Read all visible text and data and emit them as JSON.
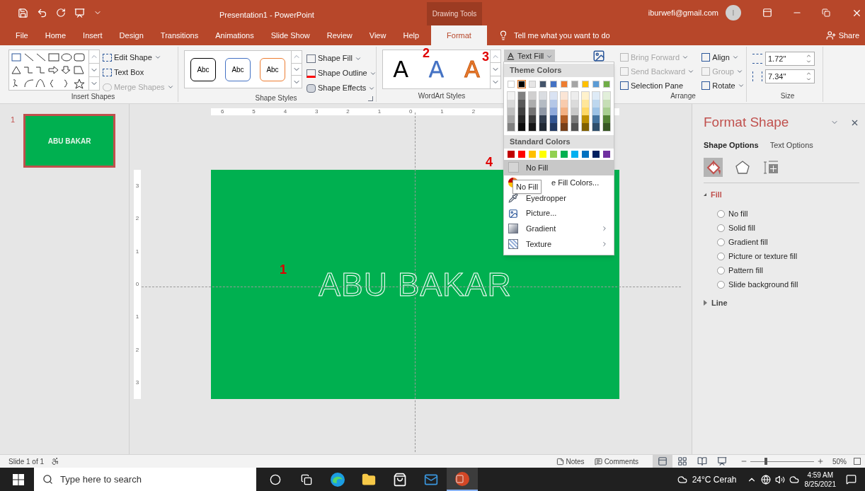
{
  "title_bar": {
    "title": "Presentation1 - PowerPoint",
    "context_tab": "Drawing Tools",
    "account": "iburwefi@gmail.com",
    "avatar_initial": "I"
  },
  "tabs": [
    {
      "label": "File",
      "selected": false
    },
    {
      "label": "Home",
      "selected": false
    },
    {
      "label": "Insert",
      "selected": false
    },
    {
      "label": "Design",
      "selected": false
    },
    {
      "label": "Transitions",
      "selected": false
    },
    {
      "label": "Animations",
      "selected": false
    },
    {
      "label": "Slide Show",
      "selected": false
    },
    {
      "label": "Review",
      "selected": false
    },
    {
      "label": "View",
      "selected": false
    },
    {
      "label": "Help",
      "selected": false
    },
    {
      "label": "Format",
      "selected": true
    }
  ],
  "tell_me": "Tell me what you want to do",
  "share": "Share",
  "ribbon": {
    "insert_shapes": {
      "label": "Insert Shapes",
      "commands": [
        {
          "label": "Edit Shape",
          "disabled": false
        },
        {
          "label": "Text Box",
          "disabled": false
        },
        {
          "label": "Merge Shapes",
          "disabled": true
        }
      ]
    },
    "shape_styles": {
      "label": "Shape Styles",
      "presets": [
        {
          "label": "Abc",
          "color": "#000000"
        },
        {
          "label": "Abc",
          "color": "#4472c4"
        },
        {
          "label": "Abc",
          "color": "#ed7d31"
        }
      ],
      "commands": [
        {
          "label": "Shape Fill"
        },
        {
          "label": "Shape Outline"
        },
        {
          "label": "Shape Effects"
        }
      ]
    },
    "wordart_styles": {
      "label": "WordArt Styles",
      "presets": [
        {
          "label": "A",
          "kind": "solid",
          "color": "#000000"
        },
        {
          "label": "A",
          "kind": "gradient",
          "color": "#4472c4"
        },
        {
          "label": "A",
          "kind": "outline",
          "color": "#ed7d31"
        }
      ],
      "text_fill": "Text Fill"
    },
    "arrange": {
      "label": "Arrange",
      "commands": [
        {
          "label": "Bring Forward",
          "disabled": true
        },
        {
          "label": "Send Backward",
          "disabled": true
        },
        {
          "label": "Selection Pane",
          "disabled": false
        },
        {
          "label": "Align",
          "disabled": false
        },
        {
          "label": "Group",
          "disabled": true
        },
        {
          "label": "Rotate",
          "disabled": false
        }
      ]
    },
    "size": {
      "label": "Size",
      "height": "1.72\"",
      "width": "7.34\""
    }
  },
  "thumbnails": [
    {
      "number": "1",
      "text": "ABU BAKAR",
      "selected": true
    }
  ],
  "rulers": {
    "horizontal": [
      "6",
      "5",
      "4",
      "3",
      "2",
      "1",
      "0",
      "1",
      "2"
    ],
    "vertical": [
      "3",
      "2",
      "1",
      "0",
      "1",
      "2",
      "3"
    ]
  },
  "slide": {
    "text": "ABU BAKAR"
  },
  "annotations": [
    {
      "label": "1"
    },
    {
      "label": "2"
    },
    {
      "label": "3"
    },
    {
      "label": "4"
    }
  ],
  "text_fill_menu": {
    "theme_header": "Theme Colors",
    "theme_colors": [
      {
        "color": "#ffffff",
        "selected": false
      },
      {
        "color": "#000000",
        "selected": true
      },
      {
        "color": "#e7e6e6",
        "selected": false
      },
      {
        "color": "#44546a",
        "selected": false
      },
      {
        "color": "#4472c4",
        "selected": false
      },
      {
        "color": "#ed7d31",
        "selected": false
      },
      {
        "color": "#a5a5a5",
        "selected": false
      },
      {
        "color": "#ffc000",
        "selected": false
      },
      {
        "color": "#5b9bd5",
        "selected": false
      },
      {
        "color": "#70ad47",
        "selected": false
      }
    ],
    "standard_header": "Standard Colors",
    "standard_colors": [
      {
        "color": "#c00000"
      },
      {
        "color": "#ff0000"
      },
      {
        "color": "#ffc000"
      },
      {
        "color": "#ffff00"
      },
      {
        "color": "#92d050"
      },
      {
        "color": "#00b050"
      },
      {
        "color": "#00b0f0"
      },
      {
        "color": "#0070c0"
      },
      {
        "color": "#002060"
      },
      {
        "color": "#7030a0"
      }
    ],
    "items": [
      {
        "label": "No Fill",
        "kind": "nofill",
        "selected": true,
        "submenu": false
      },
      {
        "label": "e Fill Colors...",
        "kind": "more",
        "selected": false,
        "submenu": false
      },
      {
        "label": "Eyedropper",
        "kind": "eyedropper",
        "selected": false,
        "submenu": false
      },
      {
        "label": "Picture...",
        "kind": "picture",
        "selected": false,
        "submenu": false
      },
      {
        "label": "Gradient",
        "kind": "gradient",
        "selected": false,
        "submenu": true
      },
      {
        "label": "Texture",
        "kind": "texture",
        "selected": false,
        "submenu": true
      }
    ],
    "tooltip": "No Fill"
  },
  "format_pane": {
    "title": "Format Shape",
    "tabs": [
      {
        "label": "Shape Options",
        "selected": true
      },
      {
        "label": "Text Options",
        "selected": false
      }
    ],
    "icons": [
      {
        "kind": "fill",
        "selected": true
      },
      {
        "kind": "effects",
        "selected": false
      },
      {
        "kind": "size",
        "selected": false
      }
    ],
    "sections": [
      {
        "label": "Fill",
        "expanded": true,
        "options": [
          {
            "label": "No fill",
            "selected": false
          },
          {
            "label": "Solid fill",
            "selected": false
          },
          {
            "label": "Gradient fill",
            "selected": false
          },
          {
            "label": "Picture or texture fill",
            "selected": false
          },
          {
            "label": "Pattern fill",
            "selected": false
          },
          {
            "label": "Slide background fill",
            "selected": false
          }
        ]
      },
      {
        "label": "Line",
        "expanded": false
      }
    ]
  },
  "status_bar": {
    "slide_info": "Slide 1 of 1",
    "notes": "Notes",
    "comments": "Comments",
    "views": [
      {
        "kind": "normal",
        "selected": true
      },
      {
        "kind": "sorter",
        "selected": false
      },
      {
        "kind": "reading",
        "selected": false
      },
      {
        "kind": "show",
        "selected": false
      }
    ],
    "zoom": {
      "level": 0.25
    },
    "zoom_reading": "50%"
  },
  "taskbar": {
    "search_placeholder": "Type here to search",
    "apps": [
      {
        "kind": "cortana",
        "selected": false
      },
      {
        "kind": "taskview",
        "selected": false
      },
      {
        "kind": "edge",
        "selected": false
      },
      {
        "kind": "explorer",
        "selected": false
      },
      {
        "kind": "store",
        "selected": false
      },
      {
        "kind": "mail",
        "selected": false
      },
      {
        "kind": "powerpoint",
        "selected": true
      }
    ],
    "weather": "24°C Cerah",
    "time": "4:59 AM",
    "date": "8/25/2021"
  }
}
